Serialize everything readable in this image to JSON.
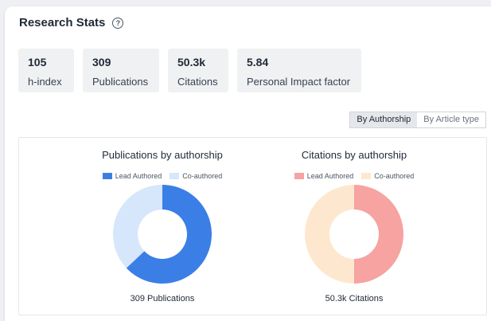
{
  "header": {
    "title": "Research Stats",
    "help_glyph": "?"
  },
  "stats": [
    {
      "value": "105",
      "label": "h-index"
    },
    {
      "value": "309",
      "label": "Publications"
    },
    {
      "value": "50.3k",
      "label": "Citations"
    },
    {
      "value": "5.84",
      "label": "Personal Impact factor"
    }
  ],
  "toggle": {
    "active": "By Authorship",
    "inactive": "By Article type"
  },
  "charts": [
    {
      "title": "Publications by authorship",
      "legend": [
        "Lead Authored",
        "Co-authored"
      ],
      "caption": "309 Publications"
    },
    {
      "title": "Citations by authorship",
      "legend": [
        "Lead Authored",
        "Co-authored"
      ],
      "caption": "50.3k Citations"
    }
  ],
  "chart_data": [
    {
      "type": "pie",
      "title": "Publications by authorship",
      "categories": [
        "Lead Authored",
        "Co-authored"
      ],
      "values": [
        63,
        37
      ],
      "colors": [
        "#3b7fe6",
        "#d6e6fb"
      ]
    },
    {
      "type": "pie",
      "title": "Citations by authorship",
      "categories": [
        "Lead Authored",
        "Co-authored"
      ],
      "values": [
        50,
        50
      ],
      "colors": [
        "#f6a3a1",
        "#fde8cf"
      ]
    }
  ]
}
